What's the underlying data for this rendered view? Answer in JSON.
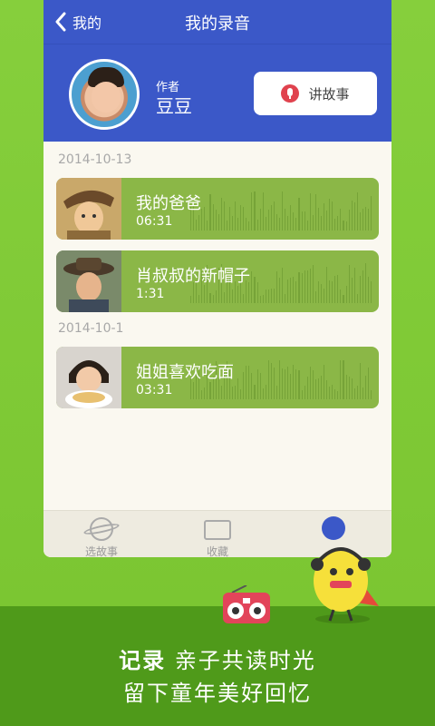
{
  "header": {
    "back_label": "我的",
    "title": "我的录音"
  },
  "profile": {
    "author_label": "作者",
    "author_name": "豆豆",
    "story_button_label": "讲故事"
  },
  "groups": [
    {
      "date": "2014-10-13",
      "recordings": [
        {
          "title": "我的爸爸",
          "duration": "06:31"
        },
        {
          "title": "肖叔叔的新帽子",
          "duration": "1:31"
        }
      ]
    },
    {
      "date": "2014-10-1",
      "recordings": [
        {
          "title": "姐姐喜欢吃面",
          "duration": "03:31"
        }
      ]
    }
  ],
  "tabs": [
    {
      "label": "选故事"
    },
    {
      "label": "收藏"
    },
    {
      "label": ""
    }
  ],
  "caption": {
    "bold": "记录",
    "line1_rest": "亲子共读时光",
    "line2": "留下童年美好回忆"
  },
  "colors": {
    "header_blue": "#3b58c8",
    "card_green": "#8bb747",
    "background_green": "#7ec83a",
    "footer_green": "#4f9a1a",
    "mic_red": "#e0424e"
  },
  "icons": [
    "back-icon",
    "mic-icon",
    "planet-icon",
    "folder-heart-icon",
    "smile-icon"
  ]
}
